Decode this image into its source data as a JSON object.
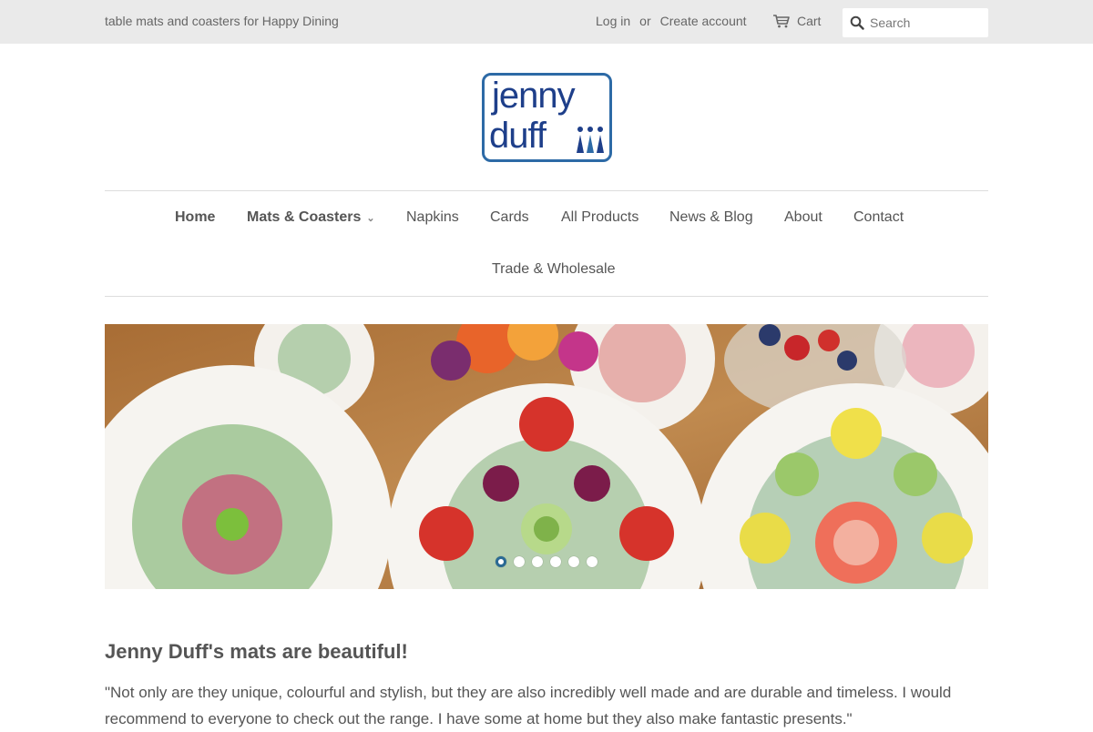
{
  "header": {
    "tagline": "table mats and coasters for Happy Dining",
    "login_label": "Log in",
    "or_label": "or",
    "create_account_label": "Create account",
    "cart_label": "Cart",
    "search_placeholder": "Search"
  },
  "logo": {
    "line1": "jenny",
    "line2": "duff",
    "brand_color": "#1e3f8a"
  },
  "nav": {
    "items": [
      {
        "label": "Home"
      },
      {
        "label": "Mats & Coasters"
      },
      {
        "label": "Napkins"
      },
      {
        "label": "Cards"
      },
      {
        "label": "All Products"
      },
      {
        "label": "News & Blog"
      },
      {
        "label": "About"
      },
      {
        "label": "Contact"
      },
      {
        "label": "Trade & Wholesale"
      }
    ],
    "dropdown_icon": "chevron-down-icon"
  },
  "hero": {
    "slide_count": 6,
    "active_slide": 1
  },
  "testimonial": {
    "heading": "Jenny Duff's mats are beautiful!",
    "quote": "\"Not only are they unique, colourful and stylish, but they are also incredibly well made and are durable and timeless. I would recommend to everyone to check out the range. I have some at home but they also make fantastic presents.\""
  },
  "colors": {
    "topbar_bg": "#eaeaea",
    "text": "#555555",
    "accent": "#2a6a94"
  }
}
